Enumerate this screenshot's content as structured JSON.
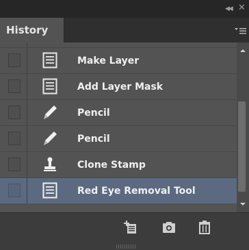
{
  "panel": {
    "title": "History",
    "controls": {
      "collapse_icon": "double-chevron-left-icon",
      "close_icon": "close-icon",
      "menu_icon": "panel-menu-icon"
    }
  },
  "history": {
    "items": [
      {
        "label": "",
        "icon": "document-icon",
        "selected": false
      },
      {
        "label": "Make Layer",
        "icon": "document-icon",
        "selected": false
      },
      {
        "label": "Add Layer Mask",
        "icon": "document-icon",
        "selected": false
      },
      {
        "label": "Pencil",
        "icon": "pencil-icon",
        "selected": false
      },
      {
        "label": "Pencil",
        "icon": "pencil-icon",
        "selected": false
      },
      {
        "label": "Clone Stamp",
        "icon": "clone-stamp-icon",
        "selected": false
      },
      {
        "label": "Red Eye Removal Tool",
        "icon": "document-icon",
        "selected": true
      }
    ]
  },
  "footer": {
    "buttons": [
      {
        "name": "new-document-from-state-button",
        "icon": "new-document-icon"
      },
      {
        "name": "new-snapshot-button",
        "icon": "camera-icon"
      },
      {
        "name": "delete-state-button",
        "icon": "trash-icon"
      }
    ]
  },
  "colors": {
    "panel_bg": "#535353",
    "selected_row": "#5b6a80",
    "titlebar": "#262626",
    "text": "#f0f0f0"
  }
}
